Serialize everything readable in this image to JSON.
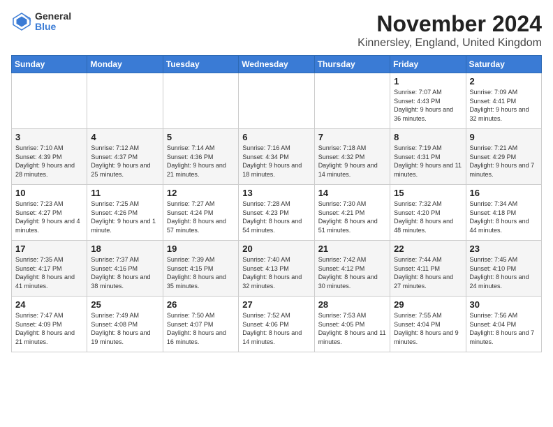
{
  "logo": {
    "general": "General",
    "blue": "Blue"
  },
  "title": "November 2024",
  "location": "Kinnersley, England, United Kingdom",
  "days_of_week": [
    "Sunday",
    "Monday",
    "Tuesday",
    "Wednesday",
    "Thursday",
    "Friday",
    "Saturday"
  ],
  "weeks": [
    [
      {
        "day": "",
        "info": ""
      },
      {
        "day": "",
        "info": ""
      },
      {
        "day": "",
        "info": ""
      },
      {
        "day": "",
        "info": ""
      },
      {
        "day": "",
        "info": ""
      },
      {
        "day": "1",
        "info": "Sunrise: 7:07 AM\nSunset: 4:43 PM\nDaylight: 9 hours and 36 minutes."
      },
      {
        "day": "2",
        "info": "Sunrise: 7:09 AM\nSunset: 4:41 PM\nDaylight: 9 hours and 32 minutes."
      }
    ],
    [
      {
        "day": "3",
        "info": "Sunrise: 7:10 AM\nSunset: 4:39 PM\nDaylight: 9 hours and 28 minutes."
      },
      {
        "day": "4",
        "info": "Sunrise: 7:12 AM\nSunset: 4:37 PM\nDaylight: 9 hours and 25 minutes."
      },
      {
        "day": "5",
        "info": "Sunrise: 7:14 AM\nSunset: 4:36 PM\nDaylight: 9 hours and 21 minutes."
      },
      {
        "day": "6",
        "info": "Sunrise: 7:16 AM\nSunset: 4:34 PM\nDaylight: 9 hours and 18 minutes."
      },
      {
        "day": "7",
        "info": "Sunrise: 7:18 AM\nSunset: 4:32 PM\nDaylight: 9 hours and 14 minutes."
      },
      {
        "day": "8",
        "info": "Sunrise: 7:19 AM\nSunset: 4:31 PM\nDaylight: 9 hours and 11 minutes."
      },
      {
        "day": "9",
        "info": "Sunrise: 7:21 AM\nSunset: 4:29 PM\nDaylight: 9 hours and 7 minutes."
      }
    ],
    [
      {
        "day": "10",
        "info": "Sunrise: 7:23 AM\nSunset: 4:27 PM\nDaylight: 9 hours and 4 minutes."
      },
      {
        "day": "11",
        "info": "Sunrise: 7:25 AM\nSunset: 4:26 PM\nDaylight: 9 hours and 1 minute."
      },
      {
        "day": "12",
        "info": "Sunrise: 7:27 AM\nSunset: 4:24 PM\nDaylight: 8 hours and 57 minutes."
      },
      {
        "day": "13",
        "info": "Sunrise: 7:28 AM\nSunset: 4:23 PM\nDaylight: 8 hours and 54 minutes."
      },
      {
        "day": "14",
        "info": "Sunrise: 7:30 AM\nSunset: 4:21 PM\nDaylight: 8 hours and 51 minutes."
      },
      {
        "day": "15",
        "info": "Sunrise: 7:32 AM\nSunset: 4:20 PM\nDaylight: 8 hours and 48 minutes."
      },
      {
        "day": "16",
        "info": "Sunrise: 7:34 AM\nSunset: 4:18 PM\nDaylight: 8 hours and 44 minutes."
      }
    ],
    [
      {
        "day": "17",
        "info": "Sunrise: 7:35 AM\nSunset: 4:17 PM\nDaylight: 8 hours and 41 minutes."
      },
      {
        "day": "18",
        "info": "Sunrise: 7:37 AM\nSunset: 4:16 PM\nDaylight: 8 hours and 38 minutes."
      },
      {
        "day": "19",
        "info": "Sunrise: 7:39 AM\nSunset: 4:15 PM\nDaylight: 8 hours and 35 minutes."
      },
      {
        "day": "20",
        "info": "Sunrise: 7:40 AM\nSunset: 4:13 PM\nDaylight: 8 hours and 32 minutes."
      },
      {
        "day": "21",
        "info": "Sunrise: 7:42 AM\nSunset: 4:12 PM\nDaylight: 8 hours and 30 minutes."
      },
      {
        "day": "22",
        "info": "Sunrise: 7:44 AM\nSunset: 4:11 PM\nDaylight: 8 hours and 27 minutes."
      },
      {
        "day": "23",
        "info": "Sunrise: 7:45 AM\nSunset: 4:10 PM\nDaylight: 8 hours and 24 minutes."
      }
    ],
    [
      {
        "day": "24",
        "info": "Sunrise: 7:47 AM\nSunset: 4:09 PM\nDaylight: 8 hours and 21 minutes."
      },
      {
        "day": "25",
        "info": "Sunrise: 7:49 AM\nSunset: 4:08 PM\nDaylight: 8 hours and 19 minutes."
      },
      {
        "day": "26",
        "info": "Sunrise: 7:50 AM\nSunset: 4:07 PM\nDaylight: 8 hours and 16 minutes."
      },
      {
        "day": "27",
        "info": "Sunrise: 7:52 AM\nSunset: 4:06 PM\nDaylight: 8 hours and 14 minutes."
      },
      {
        "day": "28",
        "info": "Sunrise: 7:53 AM\nSunset: 4:05 PM\nDaylight: 8 hours and 11 minutes."
      },
      {
        "day": "29",
        "info": "Sunrise: 7:55 AM\nSunset: 4:04 PM\nDaylight: 8 hours and 9 minutes."
      },
      {
        "day": "30",
        "info": "Sunrise: 7:56 AM\nSunset: 4:04 PM\nDaylight: 8 hours and 7 minutes."
      }
    ]
  ]
}
